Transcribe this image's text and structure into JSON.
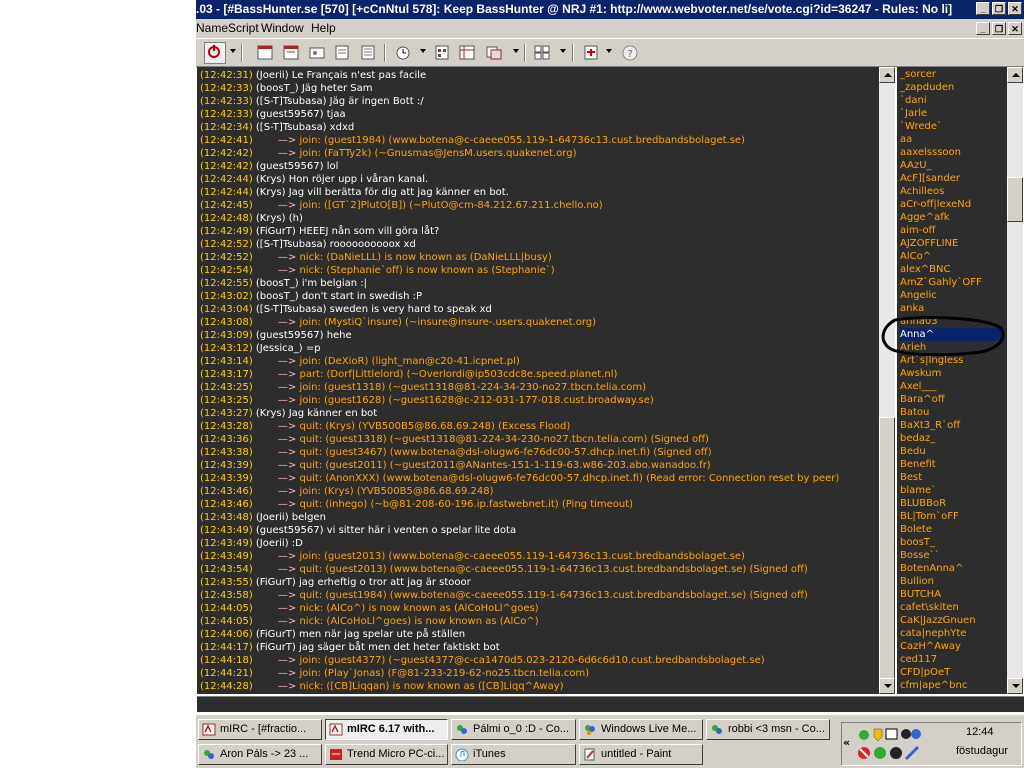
{
  "window": {
    "title": ".03 - [#BassHunter.se [570] [+cCnNtul 578]: Keep BassHunter @ NRJ #1: http://www.webvoter.net/se/vote.cgi?id=36247 - Rules: No li]"
  },
  "menu": {
    "items": [
      "NameScript",
      "Window",
      "Help"
    ]
  },
  "toolbar": {
    "icons": [
      "connect-icon",
      "options-icon",
      "channel-list-icon",
      "notify-icon",
      "url-catcher-icon",
      "address-book-icon",
      "remote-icon",
      "timer-icon",
      "colors-icon",
      "dcc-icon",
      "window-tile-icon",
      "window-cascade-icon",
      "scripts-icon",
      "help-icon"
    ]
  },
  "chat": {
    "colors": {
      "background": "#2d2d2d",
      "timestamp": "#ffd000",
      "text": "#ffffff",
      "event": "#ffa500",
      "arrow": "#ffb6c1"
    },
    "lines": [
      {
        "ts": "(12:42:31)",
        "nick": "(Joerii)",
        "text": "Le Français n'est pas facile"
      },
      {
        "ts": "(12:42:33)",
        "nick": "(boosT_)",
        "text": "Jäg heter Sam"
      },
      {
        "ts": "(12:42:33)",
        "nick": "([S-T]Tsubasa)",
        "text": "Jäg är ingen Bott :/"
      },
      {
        "ts": "(12:42:33)",
        "nick": "(guest59567)",
        "text": "tjaa"
      },
      {
        "ts": "(12:42:34)",
        "nick": "([S-T]Tsubasa)",
        "text": "xdxd"
      },
      {
        "ts": "(12:42:41)",
        "event": "join: (guest1984) (www.botena@c-caeee055.119-1-64736c13.cust.bredbandsbolaget.se)"
      },
      {
        "ts": "(12:42:42)",
        "event": "join: (FaTTy2k) (~Gnusmas@JensM.users.quakenet.org)"
      },
      {
        "ts": "(12:42:42)",
        "nick": "(guest59567)",
        "text": "lol"
      },
      {
        "ts": "(12:42:44)",
        "nick": "(Krys)",
        "text": "Hon röjer upp i våran kanal."
      },
      {
        "ts": "(12:42:44)",
        "nick": "(Krys)",
        "text": "Jag vill berätta för dig att jag känner en bot."
      },
      {
        "ts": "(12:42:45)",
        "event": "join: ([GT`2]PlutO[B]) (~PlutO@cm-84.212.67.211.chello.no)"
      },
      {
        "ts": "(12:42:48)",
        "nick": "(Krys)",
        "text": "(h)"
      },
      {
        "ts": "(12:42:49)",
        "nick": "(FiGurT)",
        "text": "HEEEJ nån som vill göra låt?"
      },
      {
        "ts": "(12:42:52)",
        "nick": "([S-T]Tsubasa)",
        "text": "roooooooooox xd"
      },
      {
        "ts": "(12:42:52)",
        "event": "nick: (DaNieLLL) is now known as (DaNieLLL|busy)"
      },
      {
        "ts": "(12:42:54)",
        "event": "nick: (Stephanie`off) is now known as (Stephanie`)"
      },
      {
        "ts": "(12:42:55)",
        "nick": "(boosT_)",
        "text": "i'm belgian :|"
      },
      {
        "ts": "(12:43:02)",
        "nick": "(boosT_)",
        "text": "don't start in swedish :P"
      },
      {
        "ts": "(12:43:04)",
        "nick": "([S-T]Tsubasa)",
        "text": "sweden is very hard to speak xd"
      },
      {
        "ts": "(12:43:08)",
        "event": "join: (MystiQ`insure) (~insure@insure-.users.quakenet.org)"
      },
      {
        "ts": "(12:43:09)",
        "nick": "(guest59567)",
        "text": "hehe"
      },
      {
        "ts": "(12:43:12)",
        "nick": "(Jessica_)",
        "text": "=p"
      },
      {
        "ts": "(12:43:14)",
        "event": "join: (DeXioR) (light_man@c20-41.icpnet.pl)"
      },
      {
        "ts": "(12:43:17)",
        "event": "part: (Dorf|Littlelord) (~Overlordi@ip503cdc8e.speed.planet.nl)"
      },
      {
        "ts": "(12:43:25)",
        "event": "join: (guest1318) (~guest1318@81-224-34-230-no27.tbcn.telia.com)"
      },
      {
        "ts": "(12:43:25)",
        "event": "join: (guest1628) (~guest1628@c-212-031-177-018.cust.broadway.se)"
      },
      {
        "ts": "(12:43:27)",
        "nick": "(Krys)",
        "text": "Jag känner en bot"
      },
      {
        "ts": "(12:43:28)",
        "event": "quit: (Krys) (YVB500B5@86.68.69.248) (Excess Flood)"
      },
      {
        "ts": "(12:43:36)",
        "event": "quit: (guest1318) (~guest1318@81-224-34-230-no27.tbcn.telia.com) (Signed off)"
      },
      {
        "ts": "(12:43:38)",
        "event": "quit: (guest3467) (www.botena@dsl-olugw6-fe76dc00-57.dhcp.inet.fi) (Signed off)"
      },
      {
        "ts": "(12:43:39)",
        "event": "quit: (guest2011) (~guest2011@ANantes-151-1-119-63.w86-203.abo.wanadoo.fr)"
      },
      {
        "ts": "(12:43:39)",
        "event": "quit: (AnonXXX) (www.botena@dsl-olugw6-fe76dc00-57.dhcp.inet.fi) (Read error: Connection reset by peer)"
      },
      {
        "ts": "(12:43:46)",
        "event": "join: (Krys) (YVB500B5@86.68.69.248)"
      },
      {
        "ts": "(12:43:46)",
        "event": "quit: (inhego) (~b@81-208-60-196.ip.fastwebnet.it) (Ping timeout)"
      },
      {
        "ts": "(12:43:48)",
        "nick": "(Joerii)",
        "text": "belgen"
      },
      {
        "ts": "(12:43:49)",
        "nick": "(guest59567)",
        "text": "vi sitter här i venten o spelar lite dota"
      },
      {
        "ts": "(12:43:49)",
        "nick": "(Joerii)",
        "text": ":D"
      },
      {
        "ts": "(12:43:49)",
        "event": "join: (guest2013) (www.botena@c-caeee055.119-1-64736c13.cust.bredbandsbolaget.se)"
      },
      {
        "ts": "(12:43:54)",
        "event": "quit: (guest2013) (www.botena@c-caeee055.119-1-64736c13.cust.bredbandsbolaget.se) (Signed off)"
      },
      {
        "ts": "(12:43:55)",
        "nick": "(FiGurT)",
        "text": "jag erheftig o tror att jag är stooor"
      },
      {
        "ts": "(12:43:58)",
        "event": "quit: (guest1984) (www.botena@c-caeee055.119-1-64736c13.cust.bredbandsbolaget.se) (Signed off)"
      },
      {
        "ts": "(12:44:05)",
        "event": "nick: (AlCo^) is now known as (AlCoHoLl^goes)"
      },
      {
        "ts": "(12:44:05)",
        "event": "nick: (AlCoHoLl^goes) is now known as (AlCo^)"
      },
      {
        "ts": "(12:44:06)",
        "nick": "(FiGurT)",
        "text": "men när jag spelar ute på ställen"
      },
      {
        "ts": "(12:44:17)",
        "nick": "(FiGurT)",
        "text": "jag säger båt men det heter faktiskt bot"
      },
      {
        "ts": "(12:44:18)",
        "event": "join: (guest4377) (~guest4377@c-ca1470d5.023-2120-6d6c6d10.cust.bredbandsbolaget.se)"
      },
      {
        "ts": "(12:44:21)",
        "event": "join: (Play`Jonas) (F@81-233-219-62-no25.tbcn.telia.com)"
      },
      {
        "ts": "(12:44:28)",
        "event": "nick: ([CB]Liqqan) is now known as ([CB]Liqq^Away)"
      }
    ]
  },
  "nicklist": {
    "selected": "Anna^",
    "items": [
      "_sorcer",
      "_zapduden",
      "`dani",
      "`Jarle",
      "`Wrede`",
      "aa",
      "aaxelsssoon",
      "AAzU_",
      "AcF][sander",
      "Achilleos",
      "aCr-off|lexeNd",
      "Agge^afk",
      "aim-off",
      "AJZOFFLINE",
      "AlCo^",
      "alex^BNC",
      "AmZ`Gahly`OFF",
      "Angelic",
      "anka",
      "anna03",
      "Anna^",
      "Arieh",
      "Art`s|Ingless",
      "Awskum",
      "Axel___",
      "Bara^off",
      "Batou",
      "BaXt3_R`off",
      "bedaz_",
      "Bedu",
      "Benefit",
      "Best",
      "blame`",
      "BLUBBoR",
      "BL|Tom`oFF",
      "Bolete",
      "boosT_",
      "Bosse``",
      "BotenAnna^",
      "Bullion",
      "BUTCHA",
      "cafet\\skiten",
      "CaK|JazzGnuen",
      "cata|nephYte",
      "CazH^Away",
      "ced117",
      "CFD|pOeT",
      "cfm|ape^bnc"
    ]
  },
  "taskbar": {
    "row1": [
      {
        "label": "mIRC - [#fractio...",
        "icon": "mirc-icon",
        "active": false
      },
      {
        "label": "mIRC 6.17 with...",
        "icon": "mirc-icon",
        "active": true
      },
      {
        "label": "Pálmi o_0 :D - Co...",
        "icon": "msn-icon",
        "active": false
      },
      {
        "label": "Windows Live Me...",
        "icon": "windows-live-icon",
        "active": false
      },
      {
        "label": "robbi <3 msn - Co...",
        "icon": "msn-icon",
        "active": false
      }
    ],
    "row2": [
      {
        "label": "Aron Páls -> 23 ...",
        "icon": "msn-icon",
        "active": false
      },
      {
        "label": "Trend Micro PC-ci...",
        "icon": "trend-micro-icon",
        "active": false
      },
      {
        "label": "iTunes",
        "icon": "itunes-icon",
        "active": false
      },
      {
        "label": "untitled - Paint",
        "icon": "paint-icon",
        "active": false
      }
    ]
  },
  "tray": {
    "chevron": "«",
    "time": "12:44",
    "day": "föstudagur"
  }
}
